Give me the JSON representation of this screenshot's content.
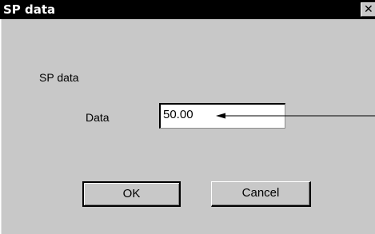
{
  "window": {
    "title": "SP data",
    "close_glyph": "✕",
    "close_icon": "close-icon"
  },
  "form": {
    "group_label": "SP data",
    "field_label": "Data",
    "field_value": "50.00"
  },
  "buttons": {
    "ok_label": "OK",
    "cancel_label": "Cancel"
  },
  "colors": {
    "titlebar": "#000000",
    "client_background": "#c8c8c8",
    "input_background": "#ffffff"
  }
}
